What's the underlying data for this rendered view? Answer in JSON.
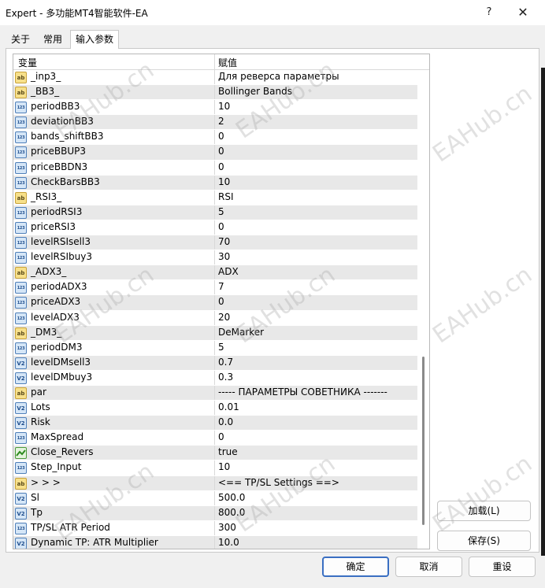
{
  "window": {
    "title": "Expert - 多功能MT4智能软件-EA",
    "help_glyph": "?",
    "close_glyph": "✕"
  },
  "tabs": [
    {
      "label": "关于"
    },
    {
      "label": "常用"
    },
    {
      "label": "输入参数",
      "active": true
    }
  ],
  "grid": {
    "columns": [
      "变量",
      "赋值"
    ],
    "rows": [
      {
        "type": "ab",
        "name": "_inp3_",
        "value": "Для реверса параметры"
      },
      {
        "type": "ab",
        "name": "_BB3_",
        "value": "Bollinger Bands"
      },
      {
        "type": "int",
        "name": "periodBB3",
        "value": "10"
      },
      {
        "type": "int",
        "name": "deviationBB3",
        "value": "2"
      },
      {
        "type": "int",
        "name": "bands_shiftBB3",
        "value": "0"
      },
      {
        "type": "int",
        "name": "priceBBUP3",
        "value": "0"
      },
      {
        "type": "int",
        "name": "priceBBDN3",
        "value": "0"
      },
      {
        "type": "int",
        "name": "CheckBarsBB3",
        "value": "10"
      },
      {
        "type": "ab",
        "name": "_RSI3_",
        "value": "RSI"
      },
      {
        "type": "int",
        "name": "periodRSI3",
        "value": "5"
      },
      {
        "type": "int",
        "name": "priceRSI3",
        "value": "0"
      },
      {
        "type": "int",
        "name": "levelRSIsell3",
        "value": "70"
      },
      {
        "type": "int",
        "name": "levelRSIbuy3",
        "value": "30"
      },
      {
        "type": "ab",
        "name": "_ADX3_",
        "value": "ADX"
      },
      {
        "type": "int",
        "name": "periodADX3",
        "value": "7"
      },
      {
        "type": "int",
        "name": "priceADX3",
        "value": "0"
      },
      {
        "type": "int",
        "name": "levelADX3",
        "value": "20"
      },
      {
        "type": "ab",
        "name": "_DM3_",
        "value": "DeMarker"
      },
      {
        "type": "int",
        "name": "periodDM3",
        "value": "5"
      },
      {
        "type": "dbl",
        "name": "levelDMsell3",
        "value": "0.7"
      },
      {
        "type": "dbl",
        "name": "levelDMbuy3",
        "value": "0.3"
      },
      {
        "type": "ab",
        "name": "par",
        "value": "----- ПАРАМЕТРЫ СОВЕТНИКА -------"
      },
      {
        "type": "dbl",
        "name": "Lots",
        "value": "0.01"
      },
      {
        "type": "dbl",
        "name": "Risk",
        "value": "0.0"
      },
      {
        "type": "int",
        "name": "MaxSpread",
        "value": "0"
      },
      {
        "type": "bool",
        "name": "Close_Revers",
        "value": "true"
      },
      {
        "type": "int",
        "name": "Step_Input",
        "value": "10"
      },
      {
        "type": "ab",
        "name": ">     >     >",
        "value": "<== TP/SL Settings ==>"
      },
      {
        "type": "dbl",
        "name": "Sl",
        "value": "500.0"
      },
      {
        "type": "dbl",
        "name": "Tp",
        "value": "800.0"
      },
      {
        "type": "int",
        "name": "TP/SL ATR Period",
        "value": "300"
      },
      {
        "type": "dbl",
        "name": "Dynamic TP: ATR Multiplier",
        "value": "10.0"
      }
    ]
  },
  "type_icons": {
    "ab": {
      "glyph": "ab",
      "icon_name": "string-type-icon"
    },
    "int": {
      "glyph": "123",
      "icon_name": "integer-type-icon"
    },
    "dbl": {
      "glyph": "V2",
      "icon_name": "double-type-icon"
    },
    "bool": {
      "glyph": "",
      "icon_name": "bool-type-icon"
    }
  },
  "buttons": {
    "load": "加载(L)",
    "save": "保存(S)",
    "ok": "确定",
    "cancel": "取消",
    "reset": "重设"
  },
  "watermark": {
    "text": "EAHub.cn",
    "color": "#aaaaaa"
  }
}
